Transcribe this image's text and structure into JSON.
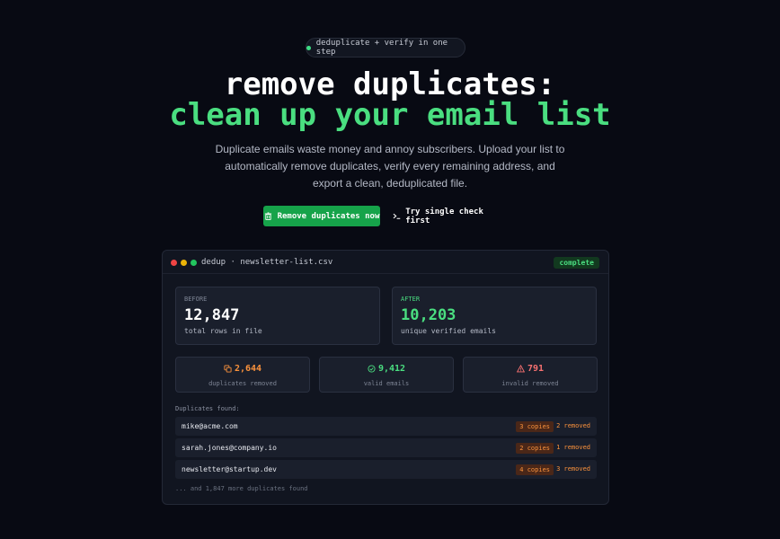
{
  "hero": {
    "badge": "deduplicate + verify in one step",
    "title_line1": "remove duplicates:",
    "title_line2": "clean up your email list",
    "subtitle": "Duplicate emails waste money and annoy subscribers. Upload your list to automatically remove duplicates, verify every remaining address, and export a clean, deduplicated file.",
    "primary_button": "Remove duplicates now",
    "secondary_button": "Try single check first"
  },
  "window": {
    "title": "dedup · newsletter-list.csv",
    "status": "complete",
    "before": {
      "label": "BEFORE",
      "value": "12,847",
      "desc": "total rows in file"
    },
    "after": {
      "label": "AFTER",
      "value": "10,203",
      "desc": "unique verified emails"
    },
    "stats": [
      {
        "value": "2,644",
        "label": "duplicates removed",
        "icon": "copy-icon"
      },
      {
        "value": "9,412",
        "label": "valid emails",
        "icon": "check-circle-icon"
      },
      {
        "value": "791",
        "label": "invalid removed",
        "icon": "warning-icon"
      }
    ],
    "duplicates_heading": "Duplicates found:",
    "duplicates": [
      {
        "email": "mike@acme.com",
        "copies": "3 copies",
        "removed": "2 removed"
      },
      {
        "email": "sarah.jones@company.io",
        "copies": "2 copies",
        "removed": "1 removed"
      },
      {
        "email": "newsletter@startup.dev",
        "copies": "4 copies",
        "removed": "3 removed"
      }
    ],
    "more_text": "... and 1,847 more duplicates found"
  },
  "colors": {
    "background": "#080a13",
    "accent_green": "#4ade80",
    "button_green": "#16a34a",
    "warning_orange": "#fb923c",
    "error_red": "#f87171"
  }
}
